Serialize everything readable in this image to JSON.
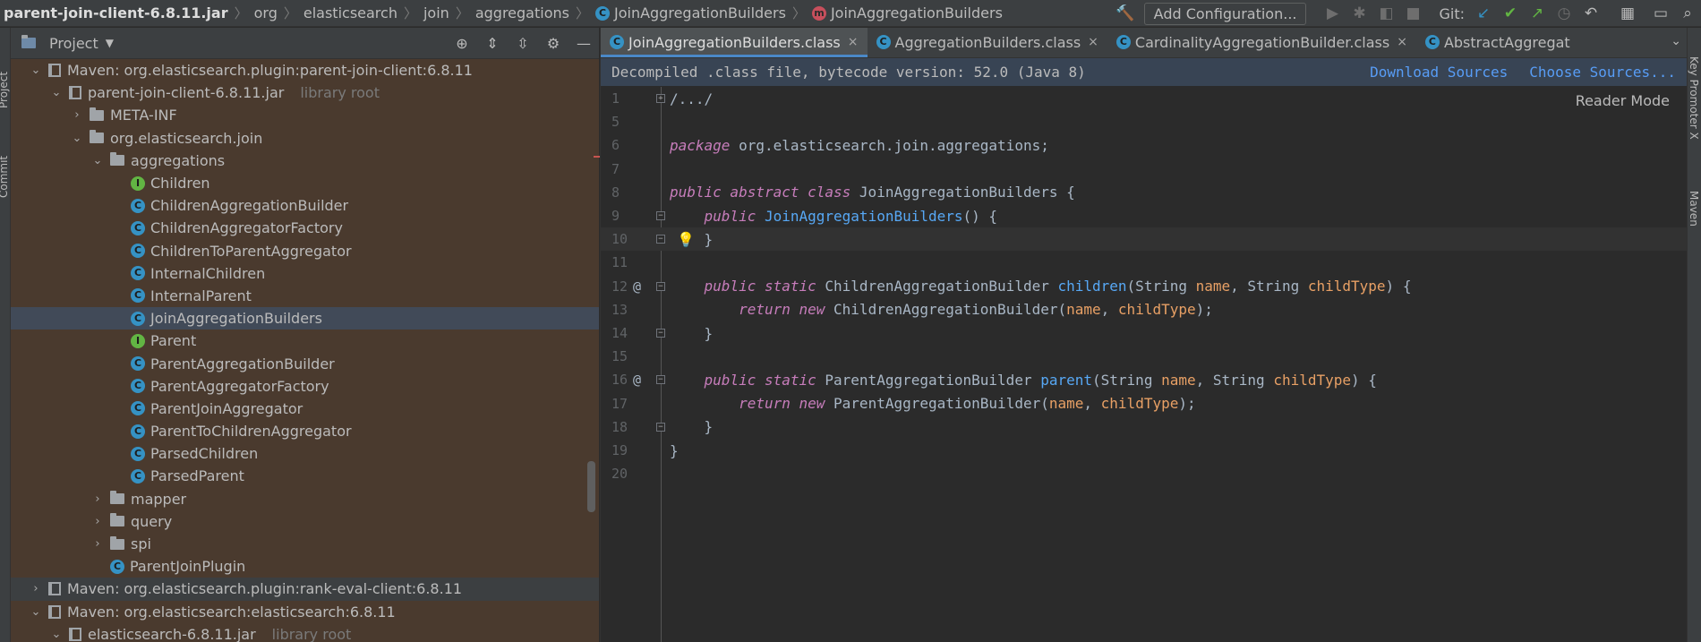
{
  "breadcrumb": {
    "items": [
      "parent-join-client-6.8.11.jar",
      "org",
      "elasticsearch",
      "join",
      "aggregations",
      "JoinAggregationBuilders",
      "JoinAggregationBuilders"
    ]
  },
  "toolbar": {
    "add_config_label": "Add Configuration...",
    "git_label": "Git:"
  },
  "left_strip": {
    "project_label": "Project",
    "commit_label": "Commit"
  },
  "project_panel": {
    "title": "Project",
    "library_root_label": "library root",
    "tree": [
      {
        "label": "Maven: org.elasticsearch.plugin:parent-join-client:6.8.11",
        "icon": "library-icon",
        "indent": 0,
        "chev": "open"
      },
      {
        "label": "parent-join-client-6.8.11.jar",
        "icon": "jar-icon",
        "indent": 1,
        "chev": "open",
        "suffix": "library root"
      },
      {
        "label": "META-INF",
        "icon": "folder-icon",
        "indent": 2,
        "chev": "closed"
      },
      {
        "label": "org.elasticsearch.join",
        "icon": "folder-icon",
        "indent": 2,
        "chev": "open"
      },
      {
        "label": "aggregations",
        "icon": "folder-icon",
        "indent": 3,
        "chev": "open"
      },
      {
        "label": "Children",
        "icon": "interface-icon",
        "indent": 4,
        "chev": "none"
      },
      {
        "label": "ChildrenAggregationBuilder",
        "icon": "class-icon",
        "indent": 4,
        "chev": "none"
      },
      {
        "label": "ChildrenAggregatorFactory",
        "icon": "class-icon",
        "indent": 4,
        "chev": "none"
      },
      {
        "label": "ChildrenToParentAggregator",
        "icon": "class-icon",
        "indent": 4,
        "chev": "none"
      },
      {
        "label": "InternalChildren",
        "icon": "class-icon",
        "indent": 4,
        "chev": "none"
      },
      {
        "label": "InternalParent",
        "icon": "class-icon",
        "indent": 4,
        "chev": "none"
      },
      {
        "label": "JoinAggregationBuilders",
        "icon": "class-icon",
        "indent": 4,
        "chev": "none",
        "selected": true
      },
      {
        "label": "Parent",
        "icon": "interface-icon",
        "indent": 4,
        "chev": "none"
      },
      {
        "label": "ParentAggregationBuilder",
        "icon": "class-icon",
        "indent": 4,
        "chev": "none"
      },
      {
        "label": "ParentAggregatorFactory",
        "icon": "class-icon",
        "indent": 4,
        "chev": "none"
      },
      {
        "label": "ParentJoinAggregator",
        "icon": "class-icon",
        "indent": 4,
        "chev": "none"
      },
      {
        "label": "ParentToChildrenAggregator",
        "icon": "class-icon",
        "indent": 4,
        "chev": "none"
      },
      {
        "label": "ParsedChildren",
        "icon": "class-icon",
        "indent": 4,
        "chev": "none"
      },
      {
        "label": "ParsedParent",
        "icon": "class-icon",
        "indent": 4,
        "chev": "none"
      },
      {
        "label": "mapper",
        "icon": "folder-icon",
        "indent": 3,
        "chev": "closed"
      },
      {
        "label": "query",
        "icon": "folder-icon",
        "indent": 3,
        "chev": "closed"
      },
      {
        "label": "spi",
        "icon": "folder-icon",
        "indent": 3,
        "chev": "closed"
      },
      {
        "label": "ParentJoinPlugin",
        "icon": "class-icon",
        "indent": 3,
        "chev": "none"
      },
      {
        "label": "Maven: org.elasticsearch.plugin:rank-eval-client:6.8.11",
        "icon": "library-icon",
        "indent": 0,
        "chev": "closed",
        "plain": true
      },
      {
        "label": "Maven: org.elasticsearch:elasticsearch:6.8.11",
        "icon": "library-icon",
        "indent": 0,
        "chev": "open"
      },
      {
        "label": "elasticsearch-6.8.11.jar",
        "icon": "jar-icon",
        "indent": 1,
        "chev": "open",
        "suffix": "library root"
      }
    ]
  },
  "editor": {
    "tabs": [
      {
        "label": "JoinAggregationBuilders.class",
        "active": true,
        "closable": true
      },
      {
        "label": "AggregationBuilders.class",
        "active": false,
        "closable": true
      },
      {
        "label": "CardinalityAggregationBuilder.class",
        "active": false,
        "closable": true
      },
      {
        "label": "AbstractAggregat",
        "active": false,
        "closable": false
      }
    ],
    "banner_text": "Decompiled .class file, bytecode version: 52.0 (Java 8)",
    "banner_links": [
      "Download Sources",
      "Choose Sources..."
    ],
    "reader_mode": "Reader Mode",
    "lines": [
      {
        "n": "1",
        "fold": "+",
        "parts": [
          {
            "t": "/.../",
            "c": "plain"
          }
        ]
      },
      {
        "n": "5",
        "parts": []
      },
      {
        "n": "6",
        "parts": [
          {
            "t": "package ",
            "c": "kwm"
          },
          {
            "t": "org.elasticsearch.join.aggregations;",
            "c": "plain"
          }
        ]
      },
      {
        "n": "7",
        "parts": []
      },
      {
        "n": "8",
        "parts": [
          {
            "t": "public abstract class ",
            "c": "kwm"
          },
          {
            "t": "JoinAggregationBuilders {",
            "c": "plain"
          }
        ]
      },
      {
        "n": "9",
        "fold": "-",
        "parts": [
          {
            "t": "    public ",
            "c": "kwm"
          },
          {
            "t": "JoinAggregationBuilders",
            "c": "fn"
          },
          {
            "t": "() {",
            "c": "plain"
          }
        ]
      },
      {
        "n": "10",
        "fold": "-",
        "bulb": true,
        "current": true,
        "parts": [
          {
            "t": "    }",
            "c": "plain"
          }
        ]
      },
      {
        "n": "11",
        "parts": []
      },
      {
        "n": "12",
        "mark": "@",
        "fold": "-",
        "parts": [
          {
            "t": "    public static ",
            "c": "kwm"
          },
          {
            "t": "ChildrenAggregationBuilder ",
            "c": "plain"
          },
          {
            "t": "children",
            "c": "fn"
          },
          {
            "t": "(String ",
            "c": "plain"
          },
          {
            "t": "name",
            "c": "prm"
          },
          {
            "t": ", String ",
            "c": "plain"
          },
          {
            "t": "childType",
            "c": "prm"
          },
          {
            "t": ") {",
            "c": "plain"
          }
        ]
      },
      {
        "n": "13",
        "parts": [
          {
            "t": "        return new ",
            "c": "kwm"
          },
          {
            "t": "ChildrenAggregationBuilder(",
            "c": "plain"
          },
          {
            "t": "name",
            "c": "prm"
          },
          {
            "t": ", ",
            "c": "plain"
          },
          {
            "t": "childType",
            "c": "prm"
          },
          {
            "t": ");",
            "c": "plain"
          }
        ]
      },
      {
        "n": "14",
        "fold": "-",
        "parts": [
          {
            "t": "    }",
            "c": "plain"
          }
        ]
      },
      {
        "n": "15",
        "parts": []
      },
      {
        "n": "16",
        "mark": "@",
        "fold": "-",
        "parts": [
          {
            "t": "    public static ",
            "c": "kwm"
          },
          {
            "t": "ParentAggregationBuilder ",
            "c": "plain"
          },
          {
            "t": "parent",
            "c": "fn"
          },
          {
            "t": "(String ",
            "c": "plain"
          },
          {
            "t": "name",
            "c": "prm"
          },
          {
            "t": ", String ",
            "c": "plain"
          },
          {
            "t": "childType",
            "c": "prm"
          },
          {
            "t": ") {",
            "c": "plain"
          }
        ]
      },
      {
        "n": "17",
        "parts": [
          {
            "t": "        return new ",
            "c": "kwm"
          },
          {
            "t": "ParentAggregationBuilder(",
            "c": "plain"
          },
          {
            "t": "name",
            "c": "prm"
          },
          {
            "t": ", ",
            "c": "plain"
          },
          {
            "t": "childType",
            "c": "prm"
          },
          {
            "t": ");",
            "c": "plain"
          }
        ]
      },
      {
        "n": "18",
        "fold": "-",
        "parts": [
          {
            "t": "    }",
            "c": "plain"
          }
        ]
      },
      {
        "n": "19",
        "parts": [
          {
            "t": "}",
            "c": "plain"
          }
        ]
      },
      {
        "n": "20",
        "parts": []
      }
    ]
  },
  "right_strip": {
    "labels": [
      "Key Promoter X",
      "Maven"
    ]
  },
  "colors": {
    "accent": "#4a88c7",
    "link": "#589df6",
    "keyword": "#c77dbb",
    "method": "#57a8f5",
    "param": "#e8a065",
    "panel_brown": "#4a3a2e"
  }
}
